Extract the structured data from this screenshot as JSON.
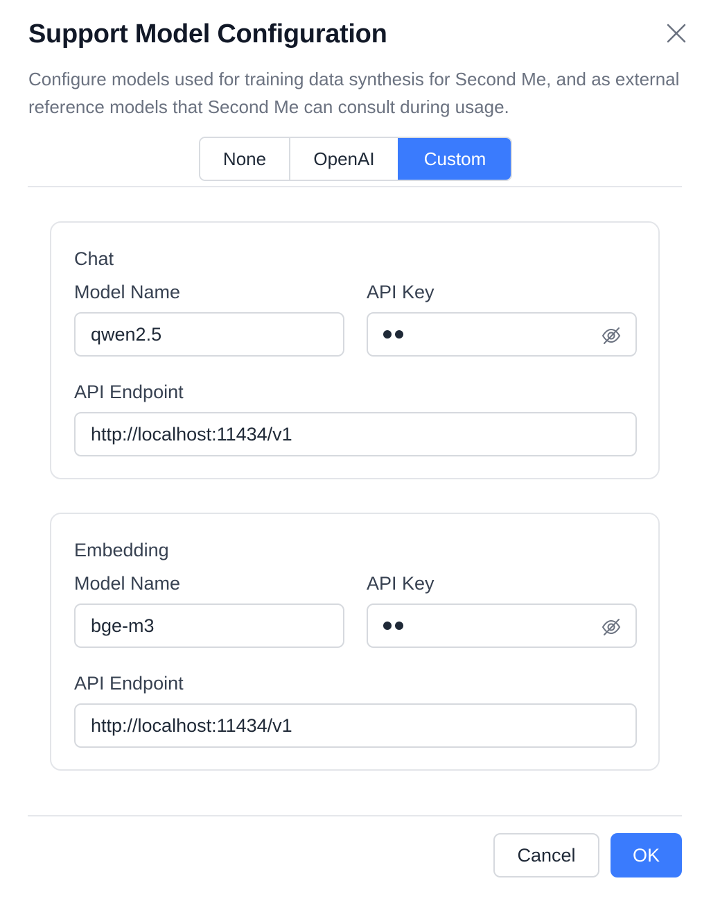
{
  "dialog": {
    "title": "Support Model Configuration",
    "description": "Configure models used for training data synthesis for Second Me, and as external reference models that Second Me can consult during usage.",
    "close_icon": "close-icon"
  },
  "provider_tabs": {
    "options": [
      "None",
      "OpenAI",
      "Custom"
    ],
    "selected": "Custom"
  },
  "chat": {
    "section_title": "Chat",
    "model_name_label": "Model Name",
    "model_name_value": "qwen2.5",
    "api_key_label": "API Key",
    "api_key_masked_chars": 2,
    "api_key_toggle_icon": "eye-off-icon",
    "endpoint_label": "API Endpoint",
    "endpoint_value": "http://localhost:11434/v1"
  },
  "embedding": {
    "section_title": "Embedding",
    "model_name_label": "Model Name",
    "model_name_value": "bge-m3",
    "api_key_label": "API Key",
    "api_key_masked_chars": 2,
    "api_key_toggle_icon": "eye-off-icon",
    "endpoint_label": "API Endpoint",
    "endpoint_value": "http://localhost:11434/v1"
  },
  "footer": {
    "cancel_label": "Cancel",
    "ok_label": "OK"
  },
  "colors": {
    "accent": "#3a7bfd",
    "title": "#111827",
    "muted_text": "#6b7280",
    "border": "#d6d9de"
  }
}
